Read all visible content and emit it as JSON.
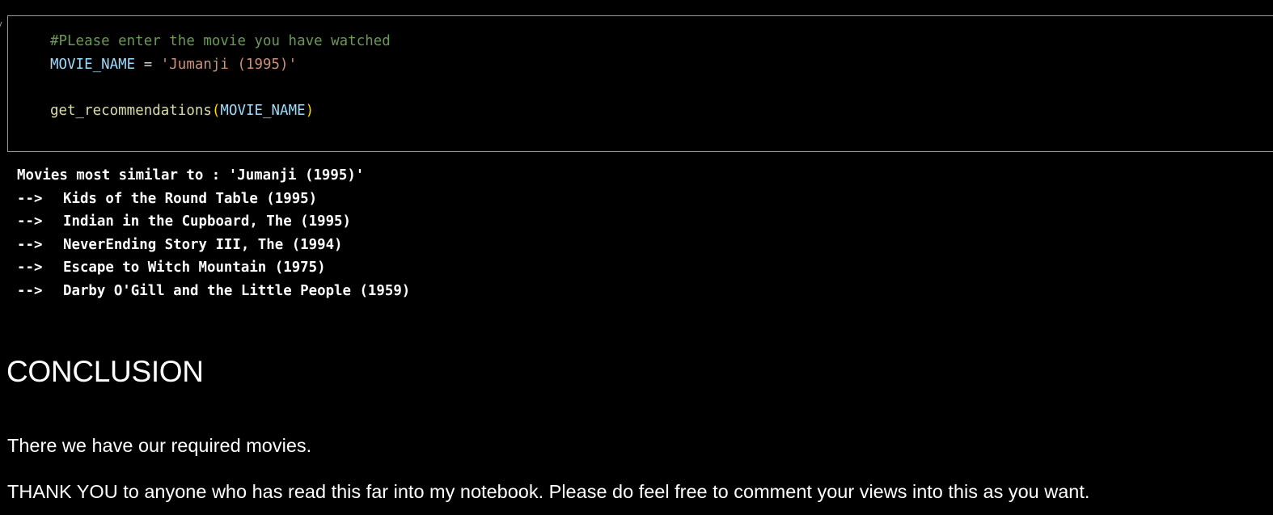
{
  "code_cell": {
    "comment": "#PLease enter the movie you have watched",
    "var_name": "MOVIE_NAME",
    "assign_op": " = ",
    "string_value": "'Jumanji (1995)'",
    "func_name": "get_recommendations",
    "open_paren": "(",
    "arg": "MOVIE_NAME",
    "close_paren": ")"
  },
  "output": {
    "header": "Movies most similar to : 'Jumanji (1995)'",
    "arrow": "-->",
    "items": [
      "Kids of the Round Table (1995)",
      "Indian in the Cupboard, The (1995)",
      "NeverEnding Story III, The (1994)",
      "Escape to Witch Mountain (1975)",
      "Darby O'Gill and the Little People (1959)"
    ]
  },
  "markdown": {
    "heading": "CONCLUSION",
    "paragraph_1": "There we have our required movies.",
    "paragraph_2": "THANK YOU to anyone who has read this far into my notebook. Please do feel free to comment your views into this as you want."
  },
  "colors": {
    "background": "#000000",
    "cell_border": "#8f98a8",
    "comment": "#6a9955",
    "variable": "#9cdcfe",
    "string": "#ce9178",
    "function": "#dcdcaa",
    "paren": "#ffd700"
  }
}
